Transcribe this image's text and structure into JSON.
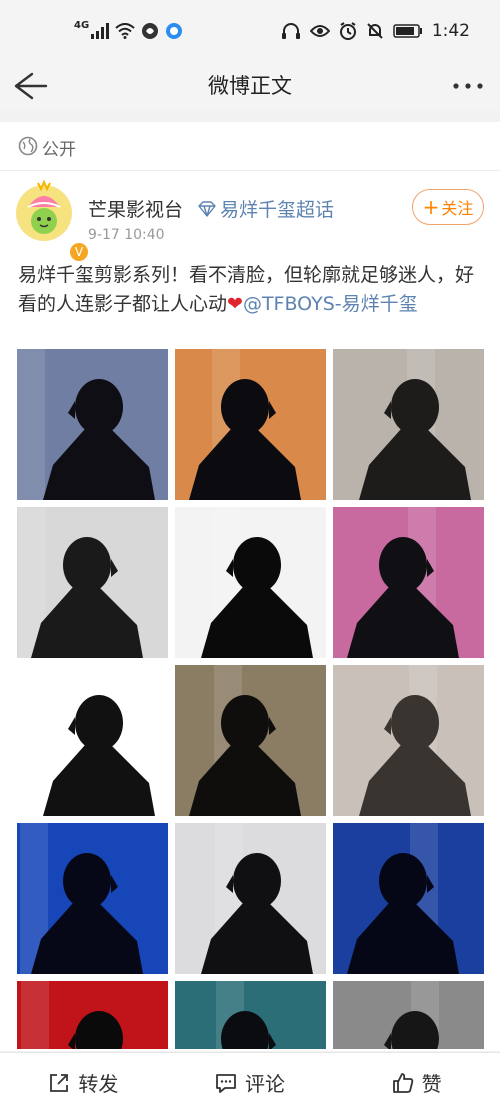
{
  "status_bar": {
    "network": "4G",
    "time": "1:42"
  },
  "nav": {
    "title": "微博正文"
  },
  "privacy": {
    "label": "公开"
  },
  "post": {
    "author": "芒果影视台",
    "topic": "易烊千玺超话",
    "time": "9-17 10:40",
    "follow_label": "关注",
    "text": "易烊千玺剪影系列！看不清脸，但轮廓就足够迷人，好看的人连影子都让人心动",
    "mention": "@TFBOYS-易烊千玺",
    "images": [
      {
        "name": "silhouette-window",
        "bg": "#6f7ea2",
        "fg": "#0e0e14"
      },
      {
        "name": "silhouette-sunset",
        "bg": "#d98a4a",
        "fg": "#0c0c10"
      },
      {
        "name": "silhouette-curtain",
        "bg": "#b9b3ab",
        "fg": "#1d1c1a"
      },
      {
        "name": "silhouette-rooftop",
        "bg": "#d8d8d8",
        "fg": "#1a1a1a"
      },
      {
        "name": "silhouette-white",
        "bg": "#f3f3f3",
        "fg": "#0a0a0a"
      },
      {
        "name": "silhouette-pink",
        "bg": "#c86aa0",
        "fg": "#101014"
      },
      {
        "name": "silhouette-bottle",
        "bg": "#ffffff",
        "fg": "#111111"
      },
      {
        "name": "silhouette-stage",
        "bg": "#8a7d64",
        "fg": "#0f0e0c"
      },
      {
        "name": "silhouette-lights",
        "bg": "#c9c0ba",
        "fg": "#3a3430"
      },
      {
        "name": "silhouette-blue-1",
        "bg": "#1746b8",
        "fg": "#060818"
      },
      {
        "name": "silhouette-pale",
        "bg": "#dcdcde",
        "fg": "#101012"
      },
      {
        "name": "silhouette-blue-2",
        "bg": "#1b3f9e",
        "fg": "#050716"
      },
      {
        "name": "silhouette-red",
        "bg": "#c0141a",
        "fg": "#0a0a0a"
      },
      {
        "name": "silhouette-teal",
        "bg": "#2c6e78",
        "fg": "#0a0c10"
      },
      {
        "name": "silhouette-grey",
        "bg": "#8a8a8a",
        "fg": "#161616"
      }
    ]
  },
  "actions": {
    "repost": "转发",
    "comment": "评论",
    "like": "赞"
  },
  "colors": {
    "accent_orange": "#ff8200",
    "link_blue": "#5d83b0"
  }
}
